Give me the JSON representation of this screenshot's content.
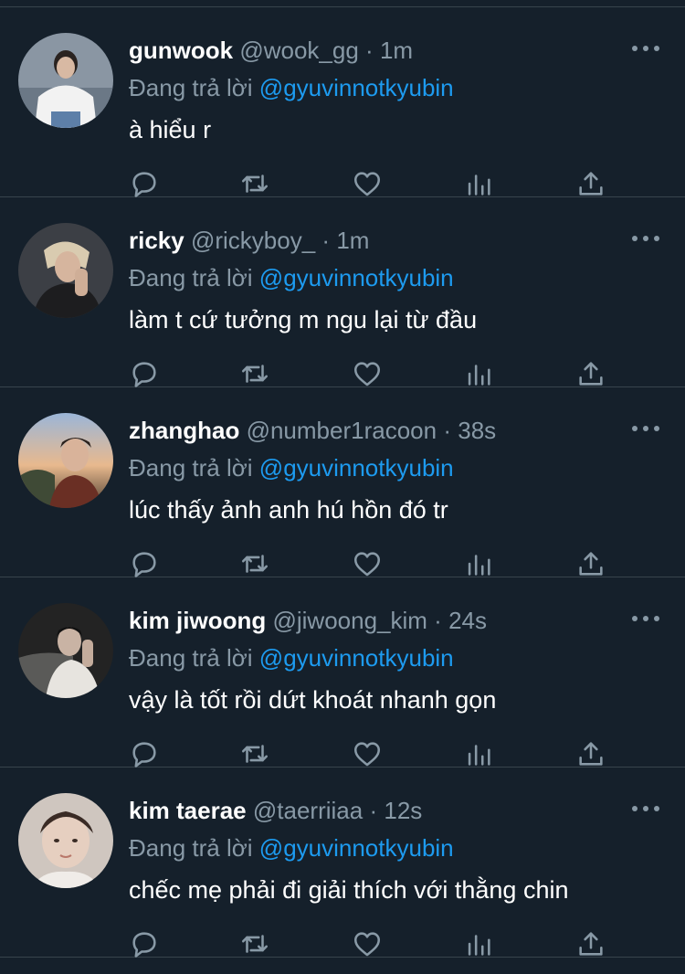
{
  "tweets": [
    {
      "name": "gunwook",
      "handle": "@wook_gg",
      "separator": "·",
      "time": "1m",
      "reply_prefix": "Đang trả lời",
      "reply_to": "@gyuvinnotkyubin",
      "text": "à hiểu r"
    },
    {
      "name": "ricky",
      "handle": "@rickyboy_",
      "separator": "·",
      "time": "1m",
      "reply_prefix": "Đang trả lời",
      "reply_to": "@gyuvinnotkyubin",
      "text": "làm t cứ tưởng m ngu lại từ đầu"
    },
    {
      "name": "zhanghao",
      "handle": "@number1racoon",
      "separator": "·",
      "time": "38s",
      "reply_prefix": "Đang trả lời",
      "reply_to": "@gyuvinnotkyubin",
      "text": "lúc thấy ảnh anh hú hồn đó tr"
    },
    {
      "name": "kim jiwoong",
      "handle": "@jiwoong_kim",
      "separator": "·",
      "time": "24s",
      "reply_prefix": "Đang trả lời",
      "reply_to": "@gyuvinnotkyubin",
      "text": "vậy là tốt rồi dứt khoát nhanh gọn"
    },
    {
      "name": "kim taerae",
      "handle": "@taerriiaa",
      "separator": "·",
      "time": "12s",
      "reply_prefix": "Đang trả lời",
      "reply_to": "@gyuvinnotkyubin",
      "text": "chếc mẹ phải đi giải thích với thằng chin"
    }
  ],
  "icons": {
    "reply": "reply-icon",
    "retweet": "retweet-icon",
    "like": "heart-icon",
    "stats": "stats-icon",
    "share": "share-icon",
    "more": "more-icon"
  },
  "colors": {
    "background": "#15202b",
    "divider": "#38444d",
    "text_primary": "#ffffff",
    "text_secondary": "#8899a6",
    "mention": "#1d9bf0"
  }
}
